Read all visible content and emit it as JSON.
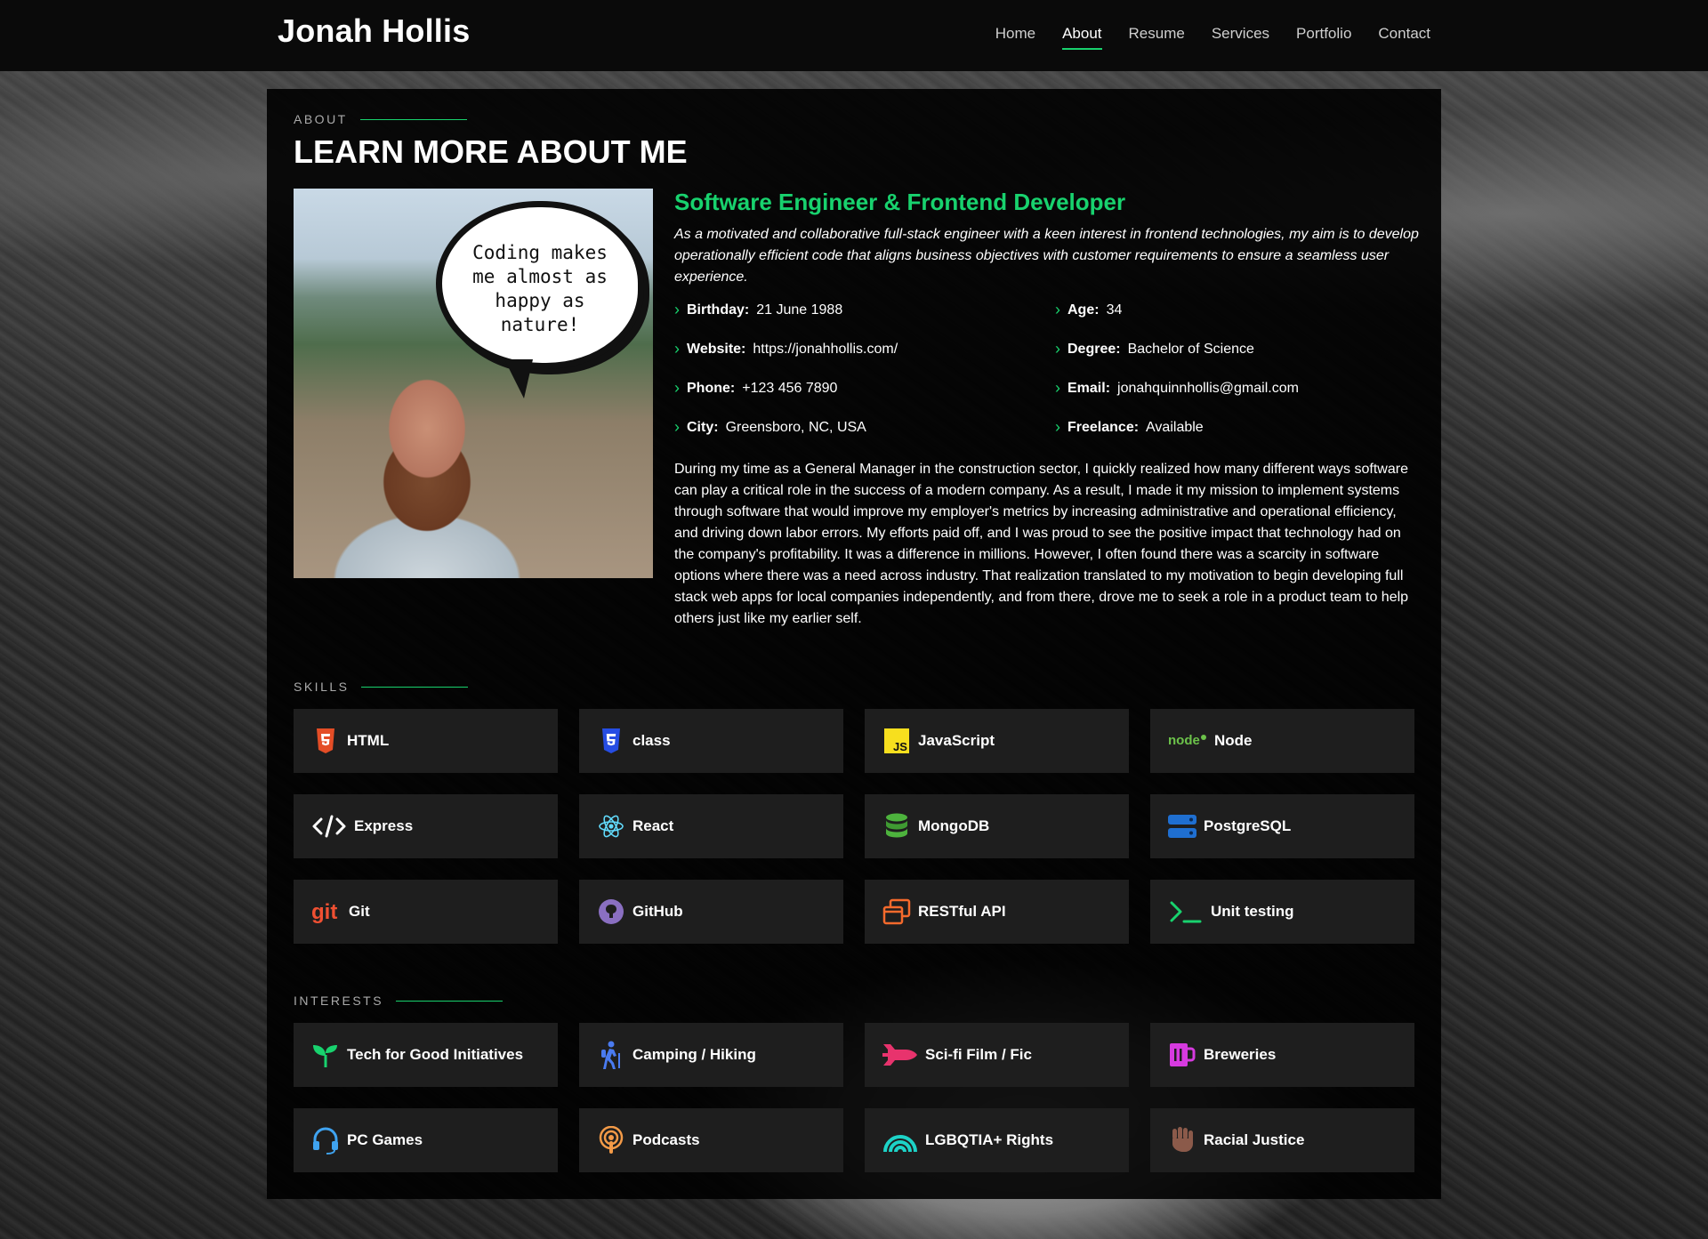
{
  "header": {
    "logo": "Jonah Hollis",
    "nav": [
      "Home",
      "About",
      "Resume",
      "Services",
      "Portfolio",
      "Contact"
    ],
    "active": "About"
  },
  "about": {
    "label": "ABOUT",
    "title": "LEARN MORE ABOUT ME",
    "bubble_text": "Coding makes me almost as happy as nature!",
    "role": "Software Engineer & Frontend Developer",
    "intro": "As a motivated and collaborative full-stack engineer with a keen interest in frontend technologies, my aim is to develop operationally efficient code that aligns business objectives with customer requirements to ensure a seamless user experience.",
    "facts": [
      {
        "k": "Birthday:",
        "v": "21 June 1988"
      },
      {
        "k": "Age:",
        "v": "34"
      },
      {
        "k": "Website:",
        "v": "https://jonahhollis.com/"
      },
      {
        "k": "Degree:",
        "v": "Bachelor of Science"
      },
      {
        "k": "Phone:",
        "v": "+123 456 7890"
      },
      {
        "k": "Email:",
        "v": "jonahquinnhollis@gmail.com"
      },
      {
        "k": "City:",
        "v": "Greensboro, NC, USA"
      },
      {
        "k": "Freelance:",
        "v": "Available"
      }
    ],
    "story": "During my time as a General Manager in the construction sector, I quickly realized how many different ways software can play a critical role in the success of a modern company. As a result, I made it my mission to implement systems through software that would improve my employer's metrics by increasing administrative and operational efficiency, and driving down labor errors. My efforts paid off, and I was proud to see the positive impact that technology had on the company's profitability. It was a difference in millions. However, I often found there was a scarcity in software options where there was a need across industry. That realization translated to my motivation to begin developing full stack web apps for local companies independently, and from there, drove me to seek a role in a product team to help others just like my earlier self."
  },
  "skills": {
    "label": "SKILLS",
    "items": [
      {
        "label": "HTML",
        "icon": "html5-icon",
        "color": "#e44d26"
      },
      {
        "label": "class",
        "icon": "css3-icon",
        "color": "#264de4"
      },
      {
        "label": "JavaScript",
        "icon": "javascript-icon",
        "color": "#f7df1e"
      },
      {
        "label": "Node",
        "icon": "node-icon",
        "color": "#6cc24a"
      },
      {
        "label": "Express",
        "icon": "code-icon",
        "color": "#ffffff"
      },
      {
        "label": "React",
        "icon": "react-icon",
        "color": "#61dafb"
      },
      {
        "label": "MongoDB",
        "icon": "database-icon",
        "color": "#4db33d"
      },
      {
        "label": "PostgreSQL",
        "icon": "server-icon",
        "color": "#1f6fd1"
      },
      {
        "label": "Git",
        "icon": "git-icon",
        "color": "#f05032"
      },
      {
        "label": "GitHub",
        "icon": "github-icon",
        "color": "#8a6fc1"
      },
      {
        "label": "RESTful API",
        "icon": "windows-icon",
        "color": "#f56a2c"
      },
      {
        "label": "Unit testing",
        "icon": "terminal-icon",
        "color": "#18d26e"
      }
    ]
  },
  "interests": {
    "label": "INTERESTS",
    "items": [
      {
        "label": "Tech for Good Initiatives",
        "icon": "sprout-icon",
        "color": "#18d26e"
      },
      {
        "label": "Camping / Hiking",
        "icon": "hiker-icon",
        "color": "#4a7bf0"
      },
      {
        "label": "Sci-fi Film / Fic",
        "icon": "rocket-icon",
        "color": "#e8336d"
      },
      {
        "label": "Breweries",
        "icon": "beer-mug-icon",
        "color": "#d63adf"
      },
      {
        "label": "PC Games",
        "icon": "headset-icon",
        "color": "#3fa3f0"
      },
      {
        "label": "Podcasts",
        "icon": "podcast-icon",
        "color": "#f39a47"
      },
      {
        "label": "LGBQTIA+ Rights",
        "icon": "rainbow-icon",
        "color": "#1dd3c7"
      },
      {
        "label": "Racial Justice",
        "icon": "fist-icon",
        "color": "#8b5a4a"
      }
    ]
  }
}
